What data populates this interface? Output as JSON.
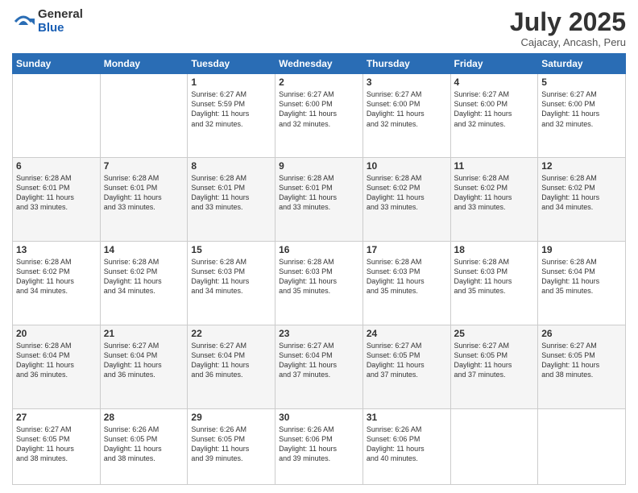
{
  "logo": {
    "general": "General",
    "blue": "Blue"
  },
  "title": {
    "month": "July 2025",
    "location": "Cajacay, Ancash, Peru"
  },
  "days_of_week": [
    "Sunday",
    "Monday",
    "Tuesday",
    "Wednesday",
    "Thursday",
    "Friday",
    "Saturday"
  ],
  "weeks": [
    [
      {
        "day": "",
        "lines": []
      },
      {
        "day": "",
        "lines": []
      },
      {
        "day": "1",
        "lines": [
          "Sunrise: 6:27 AM",
          "Sunset: 5:59 PM",
          "Daylight: 11 hours",
          "and 32 minutes."
        ]
      },
      {
        "day": "2",
        "lines": [
          "Sunrise: 6:27 AM",
          "Sunset: 6:00 PM",
          "Daylight: 11 hours",
          "and 32 minutes."
        ]
      },
      {
        "day": "3",
        "lines": [
          "Sunrise: 6:27 AM",
          "Sunset: 6:00 PM",
          "Daylight: 11 hours",
          "and 32 minutes."
        ]
      },
      {
        "day": "4",
        "lines": [
          "Sunrise: 6:27 AM",
          "Sunset: 6:00 PM",
          "Daylight: 11 hours",
          "and 32 minutes."
        ]
      },
      {
        "day": "5",
        "lines": [
          "Sunrise: 6:27 AM",
          "Sunset: 6:00 PM",
          "Daylight: 11 hours",
          "and 32 minutes."
        ]
      }
    ],
    [
      {
        "day": "6",
        "lines": [
          "Sunrise: 6:28 AM",
          "Sunset: 6:01 PM",
          "Daylight: 11 hours",
          "and 33 minutes."
        ]
      },
      {
        "day": "7",
        "lines": [
          "Sunrise: 6:28 AM",
          "Sunset: 6:01 PM",
          "Daylight: 11 hours",
          "and 33 minutes."
        ]
      },
      {
        "day": "8",
        "lines": [
          "Sunrise: 6:28 AM",
          "Sunset: 6:01 PM",
          "Daylight: 11 hours",
          "and 33 minutes."
        ]
      },
      {
        "day": "9",
        "lines": [
          "Sunrise: 6:28 AM",
          "Sunset: 6:01 PM",
          "Daylight: 11 hours",
          "and 33 minutes."
        ]
      },
      {
        "day": "10",
        "lines": [
          "Sunrise: 6:28 AM",
          "Sunset: 6:02 PM",
          "Daylight: 11 hours",
          "and 33 minutes."
        ]
      },
      {
        "day": "11",
        "lines": [
          "Sunrise: 6:28 AM",
          "Sunset: 6:02 PM",
          "Daylight: 11 hours",
          "and 33 minutes."
        ]
      },
      {
        "day": "12",
        "lines": [
          "Sunrise: 6:28 AM",
          "Sunset: 6:02 PM",
          "Daylight: 11 hours",
          "and 34 minutes."
        ]
      }
    ],
    [
      {
        "day": "13",
        "lines": [
          "Sunrise: 6:28 AM",
          "Sunset: 6:02 PM",
          "Daylight: 11 hours",
          "and 34 minutes."
        ]
      },
      {
        "day": "14",
        "lines": [
          "Sunrise: 6:28 AM",
          "Sunset: 6:02 PM",
          "Daylight: 11 hours",
          "and 34 minutes."
        ]
      },
      {
        "day": "15",
        "lines": [
          "Sunrise: 6:28 AM",
          "Sunset: 6:03 PM",
          "Daylight: 11 hours",
          "and 34 minutes."
        ]
      },
      {
        "day": "16",
        "lines": [
          "Sunrise: 6:28 AM",
          "Sunset: 6:03 PM",
          "Daylight: 11 hours",
          "and 35 minutes."
        ]
      },
      {
        "day": "17",
        "lines": [
          "Sunrise: 6:28 AM",
          "Sunset: 6:03 PM",
          "Daylight: 11 hours",
          "and 35 minutes."
        ]
      },
      {
        "day": "18",
        "lines": [
          "Sunrise: 6:28 AM",
          "Sunset: 6:03 PM",
          "Daylight: 11 hours",
          "and 35 minutes."
        ]
      },
      {
        "day": "19",
        "lines": [
          "Sunrise: 6:28 AM",
          "Sunset: 6:04 PM",
          "Daylight: 11 hours",
          "and 35 minutes."
        ]
      }
    ],
    [
      {
        "day": "20",
        "lines": [
          "Sunrise: 6:28 AM",
          "Sunset: 6:04 PM",
          "Daylight: 11 hours",
          "and 36 minutes."
        ]
      },
      {
        "day": "21",
        "lines": [
          "Sunrise: 6:27 AM",
          "Sunset: 6:04 PM",
          "Daylight: 11 hours",
          "and 36 minutes."
        ]
      },
      {
        "day": "22",
        "lines": [
          "Sunrise: 6:27 AM",
          "Sunset: 6:04 PM",
          "Daylight: 11 hours",
          "and 36 minutes."
        ]
      },
      {
        "day": "23",
        "lines": [
          "Sunrise: 6:27 AM",
          "Sunset: 6:04 PM",
          "Daylight: 11 hours",
          "and 37 minutes."
        ]
      },
      {
        "day": "24",
        "lines": [
          "Sunrise: 6:27 AM",
          "Sunset: 6:05 PM",
          "Daylight: 11 hours",
          "and 37 minutes."
        ]
      },
      {
        "day": "25",
        "lines": [
          "Sunrise: 6:27 AM",
          "Sunset: 6:05 PM",
          "Daylight: 11 hours",
          "and 37 minutes."
        ]
      },
      {
        "day": "26",
        "lines": [
          "Sunrise: 6:27 AM",
          "Sunset: 6:05 PM",
          "Daylight: 11 hours",
          "and 38 minutes."
        ]
      }
    ],
    [
      {
        "day": "27",
        "lines": [
          "Sunrise: 6:27 AM",
          "Sunset: 6:05 PM",
          "Daylight: 11 hours",
          "and 38 minutes."
        ]
      },
      {
        "day": "28",
        "lines": [
          "Sunrise: 6:26 AM",
          "Sunset: 6:05 PM",
          "Daylight: 11 hours",
          "and 38 minutes."
        ]
      },
      {
        "day": "29",
        "lines": [
          "Sunrise: 6:26 AM",
          "Sunset: 6:05 PM",
          "Daylight: 11 hours",
          "and 39 minutes."
        ]
      },
      {
        "day": "30",
        "lines": [
          "Sunrise: 6:26 AM",
          "Sunset: 6:06 PM",
          "Daylight: 11 hours",
          "and 39 minutes."
        ]
      },
      {
        "day": "31",
        "lines": [
          "Sunrise: 6:26 AM",
          "Sunset: 6:06 PM",
          "Daylight: 11 hours",
          "and 40 minutes."
        ]
      },
      {
        "day": "",
        "lines": []
      },
      {
        "day": "",
        "lines": []
      }
    ]
  ]
}
